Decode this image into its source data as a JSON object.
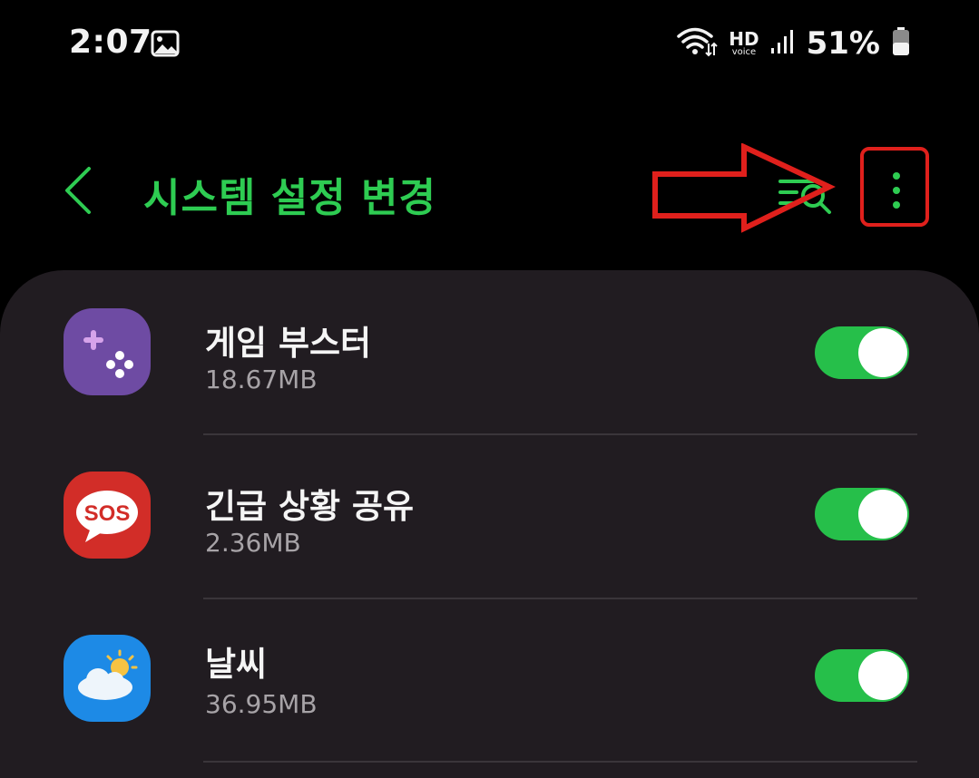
{
  "status_bar": {
    "time": "2:07",
    "hd_label": "HD",
    "voice_label": "voice",
    "battery": "51%"
  },
  "app_bar": {
    "title": "시스템 설정 변경",
    "accent_color": "#2ecc52",
    "back_icon": "chevron-left",
    "search_icon": "list-search",
    "more_icon": "more-vertical"
  },
  "annotation": {
    "arrow_color": "#e0201c"
  },
  "apps": [
    {
      "name": "게임 부스터",
      "size": "18.67MB",
      "enabled": true,
      "icon": "game-booster-icon"
    },
    {
      "name": "긴급 상황 공유",
      "size": "2.36MB",
      "enabled": true,
      "icon": "sos-icon",
      "icon_text": "SOS"
    },
    {
      "name": "날씨",
      "size": "36.95MB",
      "enabled": true,
      "icon": "weather-icon"
    }
  ]
}
